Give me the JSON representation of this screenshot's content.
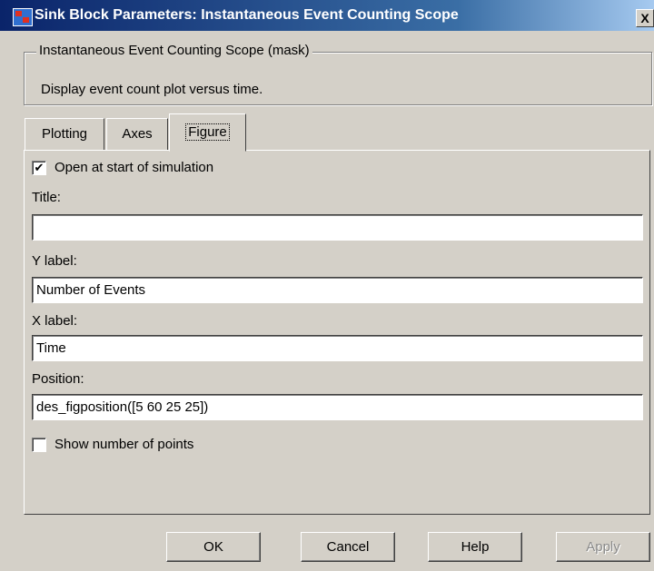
{
  "window": {
    "title": "Sink Block Parameters: Instantaneous Event Counting Scope",
    "close_label": "X"
  },
  "mask": {
    "legend": "Instantaneous Event Counting Scope (mask)",
    "description": "Display event count plot versus time."
  },
  "tabs": [
    {
      "label": "Plotting",
      "active": false
    },
    {
      "label": "Axes",
      "active": false
    },
    {
      "label": "Figure",
      "active": true
    }
  ],
  "figure": {
    "open_at_start": {
      "label": "Open at start of simulation",
      "checked": true
    },
    "title": {
      "label": "Title:",
      "value": ""
    },
    "ylabel": {
      "label": "Y label:",
      "value": "Number of Events"
    },
    "xlabel": {
      "label": "X label:",
      "value": "Time"
    },
    "position": {
      "label": "Position:",
      "value": "des_figposition([5 60 25 25])"
    },
    "show_points": {
      "label": "Show number of points",
      "checked": false
    }
  },
  "buttons": {
    "ok": "OK",
    "cancel": "Cancel",
    "help": "Help",
    "apply": "Apply"
  },
  "colors": {
    "title_bar": "#0a246a",
    "face": "#d4d0c8"
  }
}
